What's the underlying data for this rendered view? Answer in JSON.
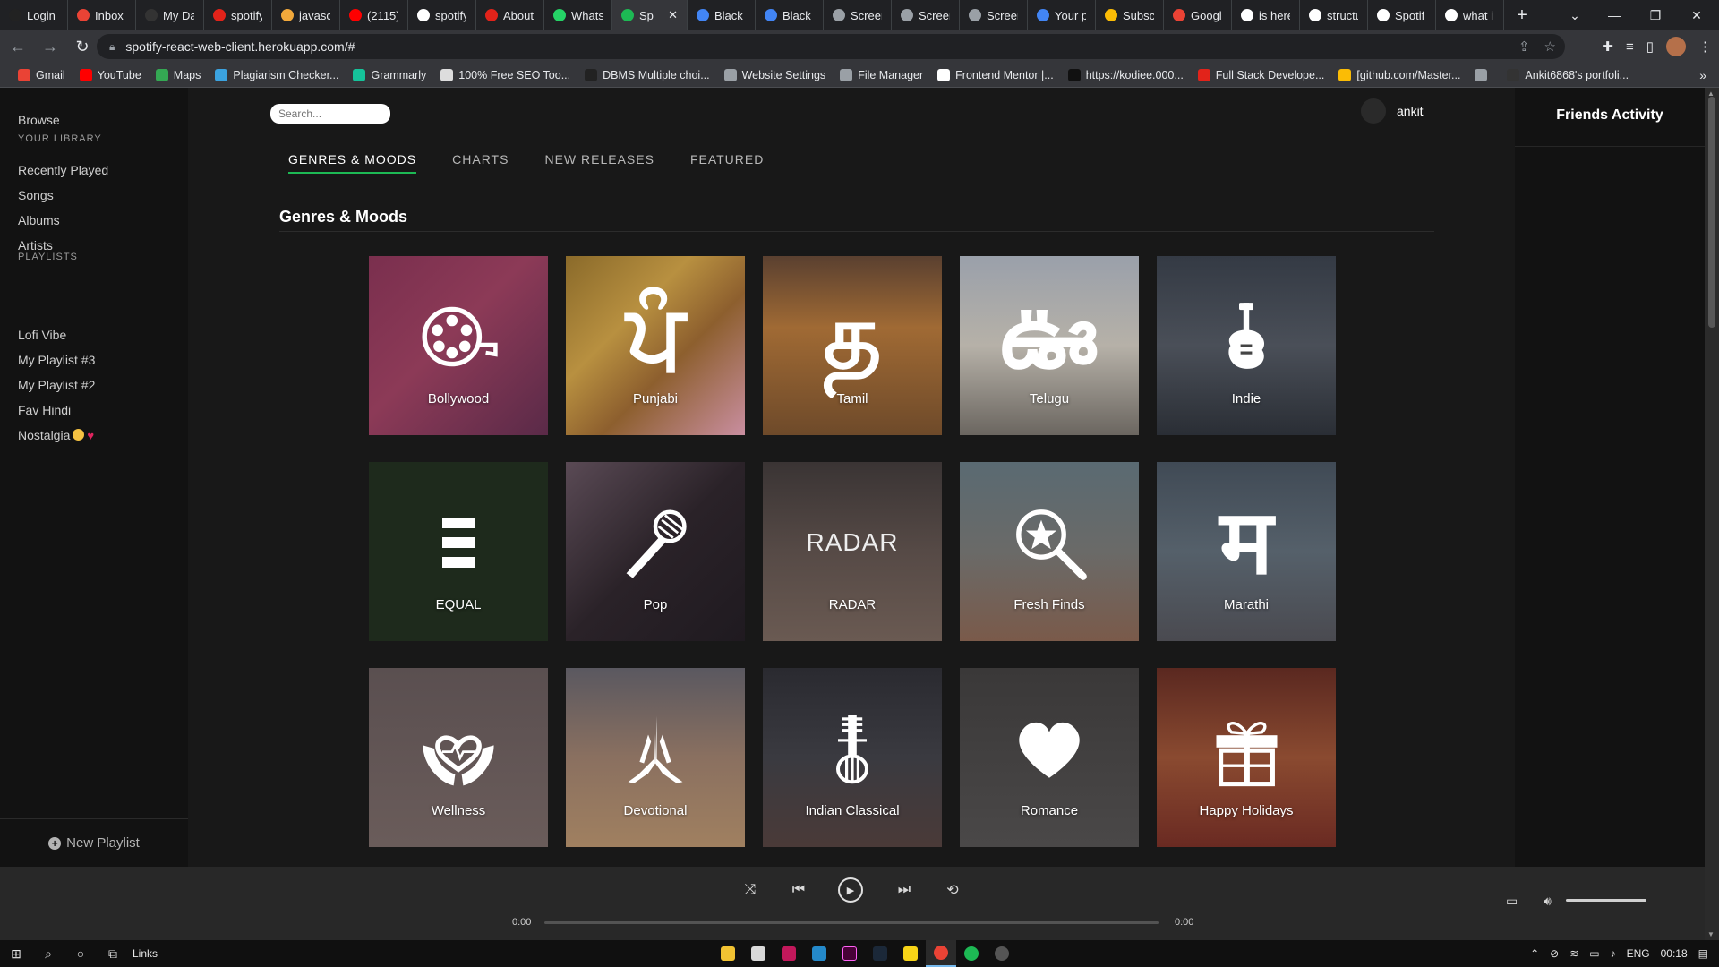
{
  "browser": {
    "tabs": [
      {
        "label": "Login",
        "color": "#222"
      },
      {
        "label": "Inbox",
        "color": "#ea4335"
      },
      {
        "label": "My Da",
        "color": "#333"
      },
      {
        "label": "spotify",
        "color": "#e2231a"
      },
      {
        "label": "javasc",
        "color": "#f2a93b"
      },
      {
        "label": "(2115)",
        "color": "#ff0000"
      },
      {
        "label": "spotify",
        "color": "#ffffff"
      },
      {
        "label": "About",
        "color": "#e2231a"
      },
      {
        "label": "Whats",
        "color": "#25d366"
      },
      {
        "label": "Sp",
        "color": "#1db954",
        "active": true
      },
      {
        "label": "Black",
        "color": "#4285f4"
      },
      {
        "label": "Black",
        "color": "#4285f4"
      },
      {
        "label": "Screen",
        "color": "#9aa0a6"
      },
      {
        "label": "Screen",
        "color": "#9aa0a6"
      },
      {
        "label": "Screen",
        "color": "#9aa0a6"
      },
      {
        "label": "Your p",
        "color": "#4285f4"
      },
      {
        "label": "Subsc",
        "color": "#fbbc05"
      },
      {
        "label": "Googl",
        "color": "#ea4335"
      },
      {
        "label": "is here",
        "color": "#ffffff"
      },
      {
        "label": "structu",
        "color": "#ffffff"
      },
      {
        "label": "Spotif",
        "color": "#ffffff"
      },
      {
        "label": "what i",
        "color": "#ffffff"
      }
    ],
    "url": "spotify-react-web-client.herokuapp.com/#",
    "bookmarks": [
      {
        "label": "Gmail",
        "color": "#ea4335"
      },
      {
        "label": "YouTube",
        "color": "#ff0000"
      },
      {
        "label": "Maps",
        "color": "#34a853"
      },
      {
        "label": "Plagiarism Checker...",
        "color": "#3ba3e0"
      },
      {
        "label": "Grammarly",
        "color": "#15c39a"
      },
      {
        "label": "100% Free SEO Too...",
        "color": "#dddddd"
      },
      {
        "label": "DBMS Multiple choi...",
        "color": "#222222"
      },
      {
        "label": "Website Settings",
        "color": "#9aa0a6"
      },
      {
        "label": "File Manager",
        "color": "#9aa0a6"
      },
      {
        "label": "Frontend Mentor |...",
        "color": "#ffffff"
      },
      {
        "label": "https://kodiee.000...",
        "color": "#111111"
      },
      {
        "label": "Full Stack Develope...",
        "color": "#e2231a"
      },
      {
        "label": "[github.com/Master...",
        "color": "#fbbc05"
      },
      {
        "label": "",
        "color": "#9aa0a6"
      },
      {
        "label": "Ankit6868's portfoli...",
        "color": "#333333"
      }
    ]
  },
  "sidebar": {
    "browse": "Browse",
    "library_heading": "YOUR LIBRARY",
    "library": [
      "Recently Played",
      "Songs",
      "Albums",
      "Artists"
    ],
    "playlists_heading": "PLAYLISTS",
    "playlists": [
      "Lofi Vibe",
      "My Playlist #3",
      "My Playlist #2",
      "Fav Hindi",
      "Nostalgia"
    ],
    "new_playlist": "New Playlist"
  },
  "header": {
    "search_placeholder": "Search...",
    "username": "ankit"
  },
  "friends": {
    "title": "Friends Activity"
  },
  "main": {
    "tabs": [
      "GENRES & MOODS",
      "CHARTS",
      "NEW RELEASES",
      "FEATURED"
    ],
    "active_tab": 0,
    "section_title": "Genres & Moods",
    "cards": [
      {
        "label": "Bollywood",
        "icon": "film-reel-icon",
        "bg": "linear-gradient(135deg,#7a2f4e 0%,#8c3a57 45%,#5a2a48 100%)"
      },
      {
        "label": "Punjabi",
        "icon": "punjabi-letter-icon",
        "glyph": "ਪੰ",
        "bg": "linear-gradient(135deg,#8a6a2a 0%,#b89040 35%,#8d5f2e 60%,#c98ea0 100%)"
      },
      {
        "label": "Tamil",
        "icon": "tamil-letter-icon",
        "glyph": "த",
        "bg": "linear-gradient(180deg,#5a4030 0%,#a06a34 40%,#6e4a2a 100%)"
      },
      {
        "label": "Telugu",
        "icon": "telugu-letter-icon",
        "glyph": "ఊ",
        "bg": "linear-gradient(180deg,#9aa0aa 0%,#b6b1a8 50%,#6b6660 100%)"
      },
      {
        "label": "Indie",
        "icon": "guitar-icon",
        "bg": "linear-gradient(180deg,#343a44 0%,#4a4f58 50%,#2a2e35 100%)"
      },
      {
        "label": "EQUAL",
        "icon": "equal-icon",
        "bg": "#1e2a1c"
      },
      {
        "label": "Pop",
        "icon": "microphone-icon",
        "bg": "linear-gradient(135deg,#5a4a55 0%,#2a2228 50%,#1f1a20 100%)"
      },
      {
        "label": "RADAR",
        "icon": "radar-word",
        "word": "RADAR",
        "bg": "linear-gradient(180deg,#3a3434 0%,#564a46 50%,#6a5a52 100%)"
      },
      {
        "label": "Fresh Finds",
        "icon": "star-search-icon",
        "bg": "linear-gradient(180deg,#5a6a72 0%,#6a6a68 50%,#7a5a4a 100%)"
      },
      {
        "label": "Marathi",
        "icon": "marathi-letter-icon",
        "glyph": "म",
        "bg": "linear-gradient(180deg,#404a55 0%,#55606a 50%,#4a4a50 100%)"
      },
      {
        "label": "Wellness",
        "icon": "heart-hands-icon",
        "bg": "linear-gradient(180deg,#5a4f50 0%,#6a5c5a 100%)"
      },
      {
        "label": "Devotional",
        "icon": "praying-hands-icon",
        "bg": "linear-gradient(180deg,#5a5860 0%,#8a7060 50%,#a08060 100%)"
      },
      {
        "label": "Indian Classical",
        "icon": "sitar-icon",
        "bg": "linear-gradient(180deg,#2a2a30 0%,#3a3a40 50%,#4a3a38 100%)"
      },
      {
        "label": "Romance",
        "icon": "heart-icon",
        "bg": "linear-gradient(180deg,#3a3838 0%,#4a4848 100%)"
      },
      {
        "label": "Happy Holidays",
        "icon": "gift-icon",
        "bg": "linear-gradient(180deg,#5a2820 0%,#8a4a30 50%,#6a2a22 100%)"
      }
    ]
  },
  "player": {
    "time_current": "0:00",
    "time_total": "0:00",
    "progress": 0,
    "volume": 1.0
  },
  "taskbar": {
    "links_label": "Links",
    "lang": "ENG",
    "time": "00:18"
  }
}
